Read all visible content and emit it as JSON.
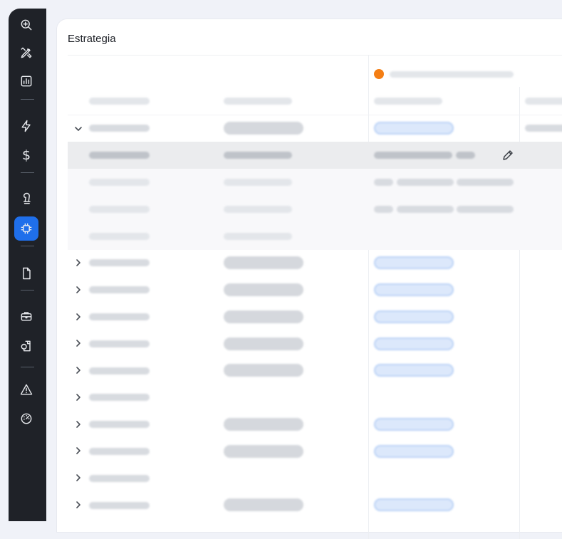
{
  "panel": {
    "title": "Estrategia"
  },
  "colors": {
    "sidebar_bg": "#1f2228",
    "active_accent": "#1f6feb",
    "status_dot": "#f47e14",
    "tag_blue": "#dce8fb"
  },
  "sidebar": {
    "items": [
      {
        "icon": "zoom-in-icon"
      },
      {
        "icon": "design-tools-icon"
      },
      {
        "icon": "bar-chart-icon"
      },
      {
        "icon": "lightning-icon"
      },
      {
        "icon": "dollar-icon"
      },
      {
        "icon": "chess-piece-icon"
      },
      {
        "icon": "chip-icon",
        "active": true
      },
      {
        "icon": "document-icon"
      },
      {
        "icon": "briefcase-icon"
      },
      {
        "icon": "shapes-icon"
      },
      {
        "icon": "warning-icon"
      },
      {
        "icon": "gauge-icon"
      }
    ]
  },
  "table": {
    "expanded_row_index": 0,
    "row_count": 15
  }
}
